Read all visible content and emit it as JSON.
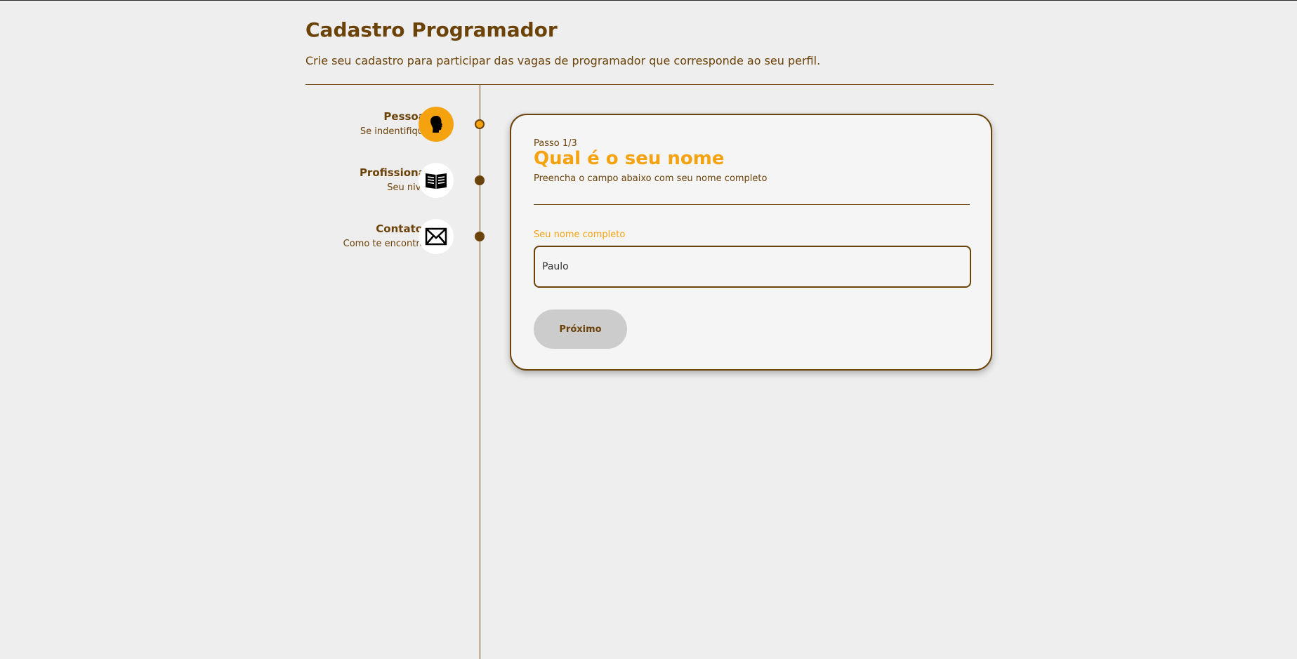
{
  "header": {
    "title": "Cadastro Programador",
    "subtitle": "Crie seu cadastro para participar das vagas de programador que corresponde ao seu perfil."
  },
  "steps": [
    {
      "title": "Pessoal",
      "description": "Se indentifique",
      "icon": "head-silhouette-icon",
      "active": true
    },
    {
      "title": "Profissional",
      "description": "Seu nivel",
      "icon": "book-icon",
      "active": false
    },
    {
      "title": "Contatos",
      "description": "Como te encontrar",
      "icon": "envelope-icon",
      "active": false
    }
  ],
  "form": {
    "step_counter": "Passo 1/3",
    "question_title": "Qual é o seu nome",
    "question_description": "Preencha o campo abaixo com seu nome completo",
    "field_label": "Seu nome completo",
    "field_value": "Paulo",
    "next_button": "Próximo"
  },
  "colors": {
    "primary_brown": "#6b4208",
    "accent_orange": "#f5a20f",
    "background": "#eeeeee",
    "button_disabled": "#cccccc"
  }
}
